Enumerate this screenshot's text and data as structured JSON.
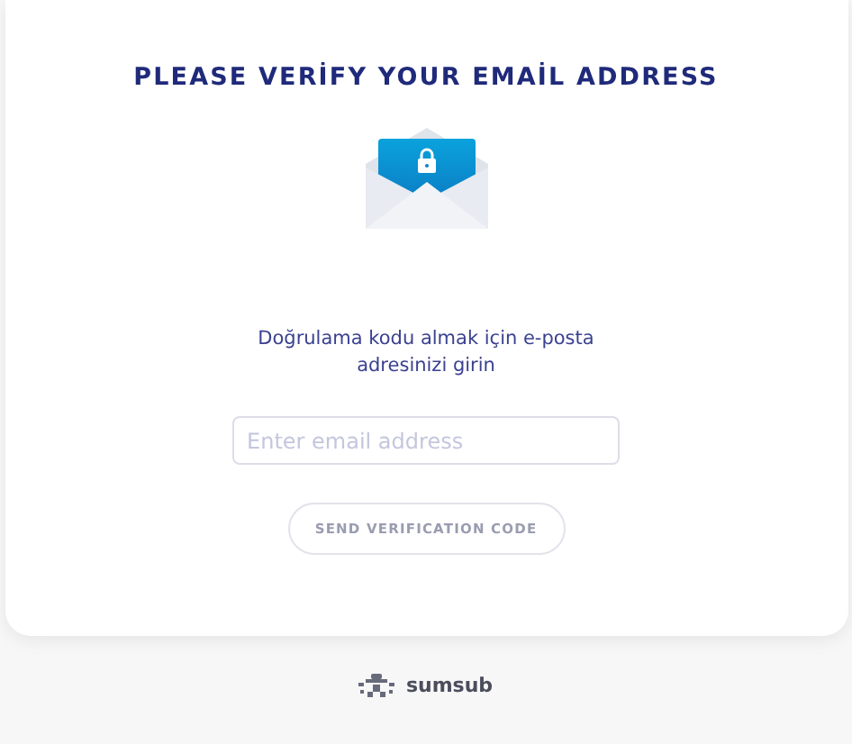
{
  "title": "PLEASE VERİFY YOUR EMAİL ADDRESS",
  "instruction": "Doğrulama kodu almak için e-posta adresinizi girin",
  "email_field": {
    "placeholder": "Enter email address"
  },
  "send_button": {
    "label": "SEND VERIFICATION CODE",
    "disabled": true
  },
  "footer": {
    "brand": "sumsub"
  }
}
